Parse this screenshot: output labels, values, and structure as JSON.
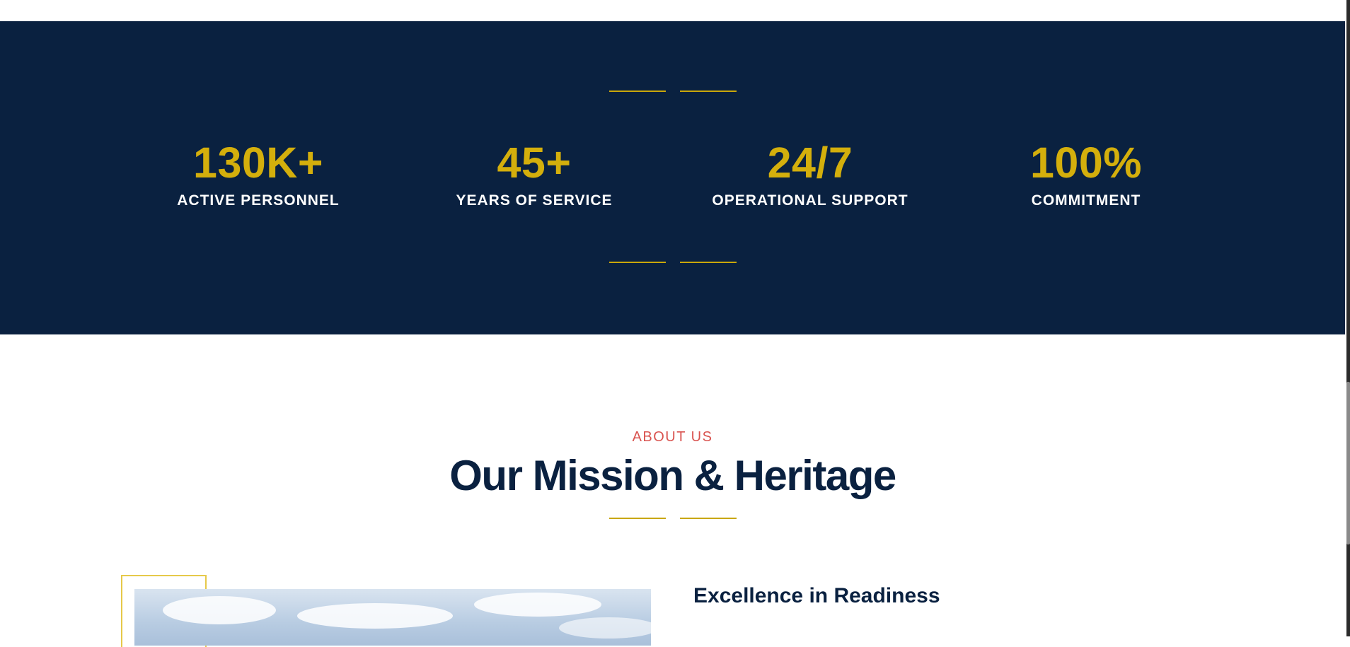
{
  "stats": {
    "items": [
      {
        "value": "130K+",
        "label": "ACTIVE PERSONNEL"
      },
      {
        "value": "45+",
        "label": "YEARS OF SERVICE"
      },
      {
        "value": "24/7",
        "label": "OPERATIONAL SUPPORT"
      },
      {
        "value": "100%",
        "label": "COMMITMENT"
      }
    ]
  },
  "about": {
    "eyebrow": "ABOUT US",
    "title": "Our Mission & Heritage",
    "subtitle": "Excellence in Readiness"
  },
  "colors": {
    "navy": "#0a2140",
    "gold": "#d4af0c",
    "accent_red": "#d9534f"
  }
}
